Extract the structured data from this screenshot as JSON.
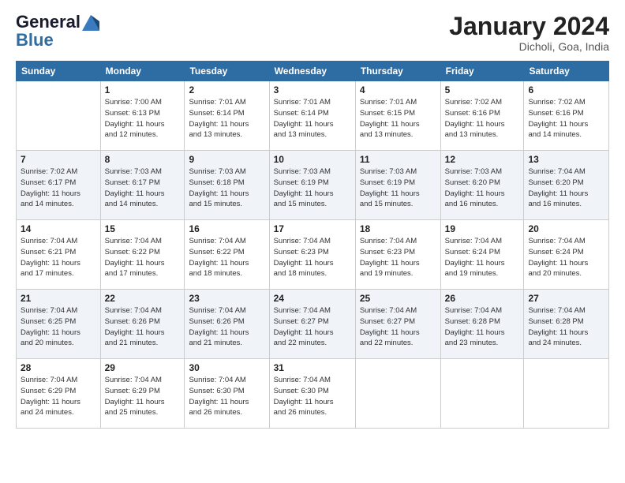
{
  "header": {
    "logo_line1": "General",
    "logo_line2": "Blue",
    "title": "January 2024",
    "subtitle": "Dicholi, Goa, India"
  },
  "columns": [
    "Sunday",
    "Monday",
    "Tuesday",
    "Wednesday",
    "Thursday",
    "Friday",
    "Saturday"
  ],
  "weeks": [
    [
      {
        "day": "",
        "info": ""
      },
      {
        "day": "1",
        "info": "Sunrise: 7:00 AM\nSunset: 6:13 PM\nDaylight: 11 hours\nand 12 minutes."
      },
      {
        "day": "2",
        "info": "Sunrise: 7:01 AM\nSunset: 6:14 PM\nDaylight: 11 hours\nand 13 minutes."
      },
      {
        "day": "3",
        "info": "Sunrise: 7:01 AM\nSunset: 6:14 PM\nDaylight: 11 hours\nand 13 minutes."
      },
      {
        "day": "4",
        "info": "Sunrise: 7:01 AM\nSunset: 6:15 PM\nDaylight: 11 hours\nand 13 minutes."
      },
      {
        "day": "5",
        "info": "Sunrise: 7:02 AM\nSunset: 6:16 PM\nDaylight: 11 hours\nand 13 minutes."
      },
      {
        "day": "6",
        "info": "Sunrise: 7:02 AM\nSunset: 6:16 PM\nDaylight: 11 hours\nand 14 minutes."
      }
    ],
    [
      {
        "day": "7",
        "info": "Sunrise: 7:02 AM\nSunset: 6:17 PM\nDaylight: 11 hours\nand 14 minutes."
      },
      {
        "day": "8",
        "info": "Sunrise: 7:03 AM\nSunset: 6:17 PM\nDaylight: 11 hours\nand 14 minutes."
      },
      {
        "day": "9",
        "info": "Sunrise: 7:03 AM\nSunset: 6:18 PM\nDaylight: 11 hours\nand 15 minutes."
      },
      {
        "day": "10",
        "info": "Sunrise: 7:03 AM\nSunset: 6:19 PM\nDaylight: 11 hours\nand 15 minutes."
      },
      {
        "day": "11",
        "info": "Sunrise: 7:03 AM\nSunset: 6:19 PM\nDaylight: 11 hours\nand 15 minutes."
      },
      {
        "day": "12",
        "info": "Sunrise: 7:03 AM\nSunset: 6:20 PM\nDaylight: 11 hours\nand 16 minutes."
      },
      {
        "day": "13",
        "info": "Sunrise: 7:04 AM\nSunset: 6:20 PM\nDaylight: 11 hours\nand 16 minutes."
      }
    ],
    [
      {
        "day": "14",
        "info": "Sunrise: 7:04 AM\nSunset: 6:21 PM\nDaylight: 11 hours\nand 17 minutes."
      },
      {
        "day": "15",
        "info": "Sunrise: 7:04 AM\nSunset: 6:22 PM\nDaylight: 11 hours\nand 17 minutes."
      },
      {
        "day": "16",
        "info": "Sunrise: 7:04 AM\nSunset: 6:22 PM\nDaylight: 11 hours\nand 18 minutes."
      },
      {
        "day": "17",
        "info": "Sunrise: 7:04 AM\nSunset: 6:23 PM\nDaylight: 11 hours\nand 18 minutes."
      },
      {
        "day": "18",
        "info": "Sunrise: 7:04 AM\nSunset: 6:23 PM\nDaylight: 11 hours\nand 19 minutes."
      },
      {
        "day": "19",
        "info": "Sunrise: 7:04 AM\nSunset: 6:24 PM\nDaylight: 11 hours\nand 19 minutes."
      },
      {
        "day": "20",
        "info": "Sunrise: 7:04 AM\nSunset: 6:24 PM\nDaylight: 11 hours\nand 20 minutes."
      }
    ],
    [
      {
        "day": "21",
        "info": "Sunrise: 7:04 AM\nSunset: 6:25 PM\nDaylight: 11 hours\nand 20 minutes."
      },
      {
        "day": "22",
        "info": "Sunrise: 7:04 AM\nSunset: 6:26 PM\nDaylight: 11 hours\nand 21 minutes."
      },
      {
        "day": "23",
        "info": "Sunrise: 7:04 AM\nSunset: 6:26 PM\nDaylight: 11 hours\nand 21 minutes."
      },
      {
        "day": "24",
        "info": "Sunrise: 7:04 AM\nSunset: 6:27 PM\nDaylight: 11 hours\nand 22 minutes."
      },
      {
        "day": "25",
        "info": "Sunrise: 7:04 AM\nSunset: 6:27 PM\nDaylight: 11 hours\nand 22 minutes."
      },
      {
        "day": "26",
        "info": "Sunrise: 7:04 AM\nSunset: 6:28 PM\nDaylight: 11 hours\nand 23 minutes."
      },
      {
        "day": "27",
        "info": "Sunrise: 7:04 AM\nSunset: 6:28 PM\nDaylight: 11 hours\nand 24 minutes."
      }
    ],
    [
      {
        "day": "28",
        "info": "Sunrise: 7:04 AM\nSunset: 6:29 PM\nDaylight: 11 hours\nand 24 minutes."
      },
      {
        "day": "29",
        "info": "Sunrise: 7:04 AM\nSunset: 6:29 PM\nDaylight: 11 hours\nand 25 minutes."
      },
      {
        "day": "30",
        "info": "Sunrise: 7:04 AM\nSunset: 6:30 PM\nDaylight: 11 hours\nand 26 minutes."
      },
      {
        "day": "31",
        "info": "Sunrise: 7:04 AM\nSunset: 6:30 PM\nDaylight: 11 hours\nand 26 minutes."
      },
      {
        "day": "",
        "info": ""
      },
      {
        "day": "",
        "info": ""
      },
      {
        "day": "",
        "info": ""
      }
    ]
  ]
}
